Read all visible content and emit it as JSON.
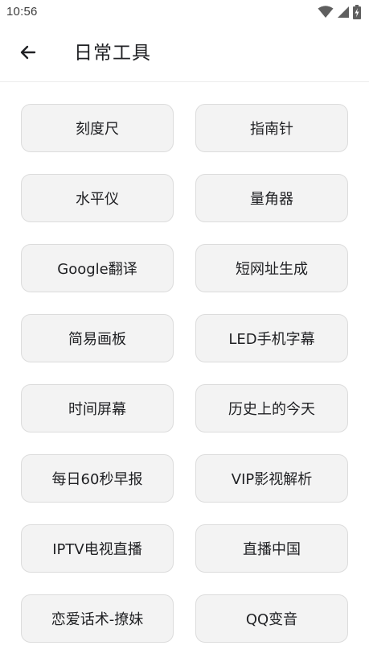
{
  "status_bar": {
    "time": "10:56",
    "icons": [
      "wifi-icon",
      "signal-icon",
      "battery-charging-icon"
    ]
  },
  "app_bar": {
    "back_icon": "arrow-left-icon",
    "title": "日常工具"
  },
  "tools": [
    {
      "id": "ruler",
      "label": "刻度尺"
    },
    {
      "id": "compass",
      "label": "指南针"
    },
    {
      "id": "level",
      "label": "水平仪"
    },
    {
      "id": "protractor",
      "label": "量角器"
    },
    {
      "id": "google-translate",
      "label": "Google翻译"
    },
    {
      "id": "short-url",
      "label": "短网址生成"
    },
    {
      "id": "drawing-board",
      "label": "简易画板"
    },
    {
      "id": "led-banner",
      "label": "LED手机字幕"
    },
    {
      "id": "time-screen",
      "label": "时间屏幕"
    },
    {
      "id": "history-today",
      "label": "历史上的今天"
    },
    {
      "id": "daily-60s",
      "label": "每日60秒早报"
    },
    {
      "id": "vip-video",
      "label": "VIP影视解析"
    },
    {
      "id": "iptv",
      "label": "IPTV电视直播"
    },
    {
      "id": "live-china",
      "label": "直播中国"
    },
    {
      "id": "pickup-lines",
      "label": "恋爱话术-撩妹"
    },
    {
      "id": "qq-voice",
      "label": "QQ变音"
    }
  ],
  "colors": {
    "button_bg": "#f3f3f3",
    "button_border": "#dcdcdc",
    "text": "#202124"
  }
}
